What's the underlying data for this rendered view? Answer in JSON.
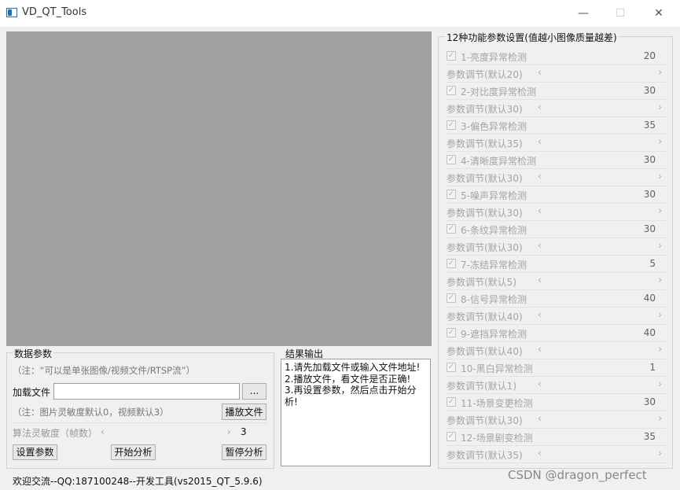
{
  "window": {
    "title": "VD_QT_Tools",
    "minimize": "—",
    "maximize": "☐",
    "close": "✕"
  },
  "data_params": {
    "title": "数据参数",
    "note1": "（注：“可以是单张图像/视频文件/RTSP流”）",
    "load_label": "加载文件",
    "load_value": "",
    "browse_label": "...",
    "note2": "（注：图片灵敏度默认0，视频默认3）",
    "play_label": "播放文件",
    "sensitivity_label": "算法灵敏度（帧数）",
    "sensitivity_value": "3",
    "set_label": "设置参数",
    "start_label": "开始分析",
    "pause_label": "暂停分析"
  },
  "result": {
    "title": "结果输出",
    "lines": [
      "1.请先加载文件或输入文件地址!",
      "2.播放文件，看文件是否正确!",
      "3.再设置参数，然后点击开始分析!"
    ]
  },
  "settings": {
    "title": "12种功能参数设置(值越小图像质量越差)",
    "items": [
      {
        "label": "1-亮度异常检测",
        "value": "20",
        "sub": "参数调节(默认20)"
      },
      {
        "label": "2-对比度异常检测",
        "value": "30",
        "sub": "参数调节(默认30)"
      },
      {
        "label": "3-偏色异常检测",
        "value": "35",
        "sub": "参数调节(默认35)"
      },
      {
        "label": "4-清晰度异常检测",
        "value": "30",
        "sub": "参数调节(默认30)"
      },
      {
        "label": "5-噪声异常检测",
        "value": "30",
        "sub": "参数调节(默认30)"
      },
      {
        "label": "6-条纹异常检测",
        "value": "30",
        "sub": "参数调节(默认30)"
      },
      {
        "label": "7-冻结异常检测",
        "value": "5",
        "sub": "参数调节(默认5)"
      },
      {
        "label": "8-信号异常检测",
        "value": "40",
        "sub": "参数调节(默认40)"
      },
      {
        "label": "9-遮挡异常检测",
        "value": "40",
        "sub": "参数调节(默认40)"
      },
      {
        "label": "10-黑白异常检测",
        "value": "1",
        "sub": "参数调节(默认1)"
      },
      {
        "label": "11-场景变更检测",
        "value": "30",
        "sub": "参数调节(默认30)"
      },
      {
        "label": "12-场景剧变检测",
        "value": "35",
        "sub": "参数调节(默认35)"
      }
    ]
  },
  "status": "欢迎交流--QQ:187100248--开发工具(vs2015_QT_5.9.6)",
  "watermark": "CSDN @dragon_perfect"
}
